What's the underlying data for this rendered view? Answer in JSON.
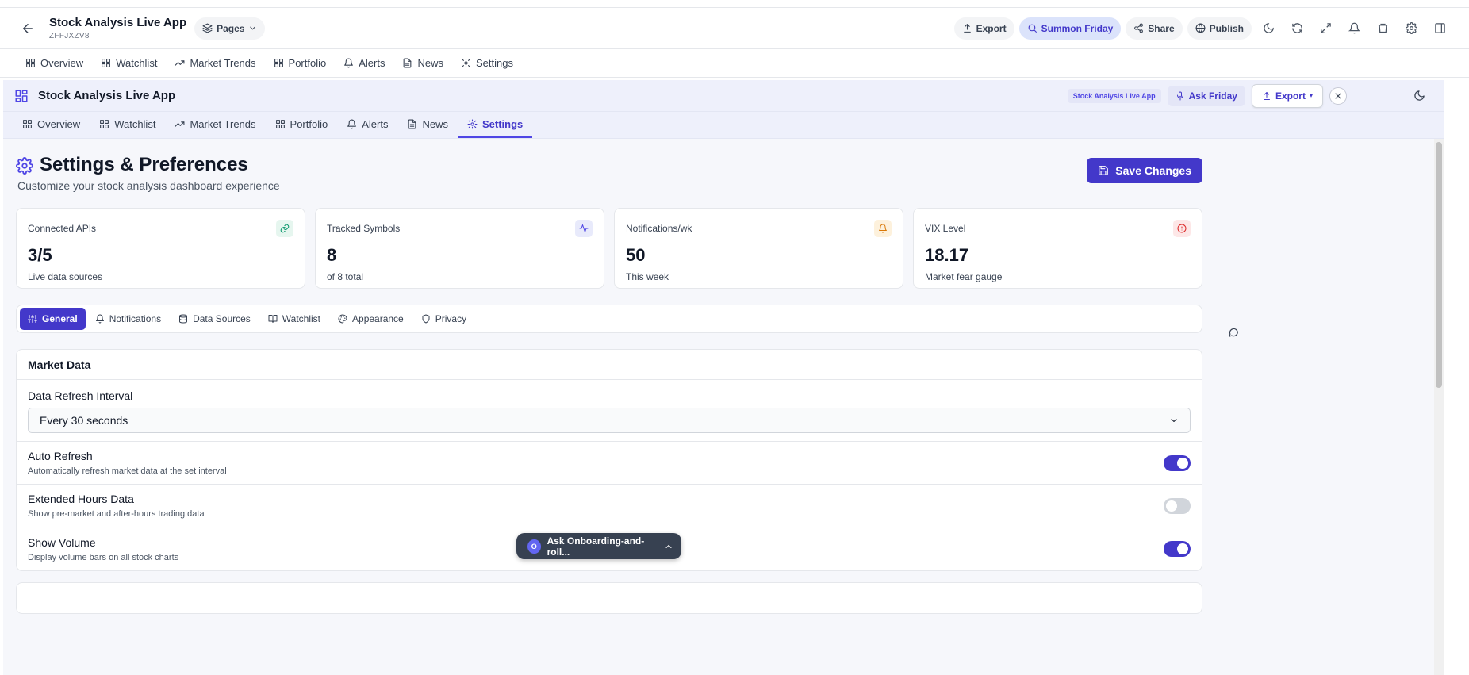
{
  "app": {
    "title": "Stock Analysis Live App",
    "id": "ZFFJXZV8",
    "pages_label": "Pages"
  },
  "header_actions": {
    "export": "Export",
    "summon": "Summon Friday",
    "share": "Share",
    "publish": "Publish"
  },
  "outer_tabs": [
    {
      "label": "Overview",
      "icon": "grid-icon"
    },
    {
      "label": "Watchlist",
      "icon": "grid-icon"
    },
    {
      "label": "Market Trends",
      "icon": "trending-up-icon"
    },
    {
      "label": "Portfolio",
      "icon": "grid-icon"
    },
    {
      "label": "Alerts",
      "icon": "bell-icon"
    },
    {
      "label": "News",
      "icon": "file-icon"
    },
    {
      "label": "Settings",
      "icon": "gear-icon"
    }
  ],
  "inner_header": {
    "title": "Stock Analysis Live App",
    "badge": "Stock Analysis Live App",
    "ask_friday": "Ask Friday",
    "export": "Export"
  },
  "inner_tabs": [
    {
      "label": "Overview",
      "icon": "grid-icon",
      "active": false
    },
    {
      "label": "Watchlist",
      "icon": "grid-icon",
      "active": false
    },
    {
      "label": "Market Trends",
      "icon": "trending-up-icon",
      "active": false
    },
    {
      "label": "Portfolio",
      "icon": "grid-icon",
      "active": false
    },
    {
      "label": "Alerts",
      "icon": "bell-icon",
      "active": false
    },
    {
      "label": "News",
      "icon": "file-icon",
      "active": false
    },
    {
      "label": "Settings",
      "icon": "gear-icon",
      "active": true
    }
  ],
  "page": {
    "title": "Settings & Preferences",
    "subtitle": "Customize your stock analysis dashboard experience",
    "save_label": "Save Changes"
  },
  "stats": [
    {
      "label": "Connected APIs",
      "value": "3/5",
      "desc": "Live data sources",
      "icon": "link-icon",
      "color": "#059669",
      "bg": "#e6f6ef"
    },
    {
      "label": "Tracked Symbols",
      "value": "8",
      "desc": "of 8 total",
      "icon": "activity-icon",
      "color": "#4f46e5",
      "bg": "#e8eafb"
    },
    {
      "label": "Notifications/wk",
      "value": "50",
      "desc": "This week",
      "icon": "bell-icon",
      "color": "#d97706",
      "bg": "#fdf1dc"
    },
    {
      "label": "VIX Level",
      "value": "18.17",
      "desc": "Market fear gauge",
      "icon": "alert-circle-icon",
      "color": "#dc2626",
      "bg": "#fde7e7"
    }
  ],
  "settings_tabs": [
    {
      "label": "General",
      "icon": "sliders-icon",
      "active": true
    },
    {
      "label": "Notifications",
      "icon": "bell-icon",
      "active": false
    },
    {
      "label": "Data Sources",
      "icon": "database-icon",
      "active": false
    },
    {
      "label": "Watchlist",
      "icon": "book-icon",
      "active": false
    },
    {
      "label": "Appearance",
      "icon": "palette-icon",
      "active": false
    },
    {
      "label": "Privacy",
      "icon": "shield-icon",
      "active": false
    }
  ],
  "market_data": {
    "heading": "Market Data",
    "refresh_label": "Data Refresh Interval",
    "refresh_value": "Every 30 seconds",
    "toggles": [
      {
        "label": "Auto Refresh",
        "desc": "Automatically refresh market data at the set interval",
        "on": true
      },
      {
        "label": "Extended Hours Data",
        "desc": "Show pre-market and after-hours trading data",
        "on": false
      },
      {
        "label": "Show Volume",
        "desc": "Display volume bars on all stock charts",
        "on": true
      }
    ]
  },
  "chat": {
    "avatar": "O",
    "label": "Ask Onboarding-and-roll..."
  },
  "colors": {
    "accent": "#4338ca",
    "accent_light": "#4f46e5"
  }
}
